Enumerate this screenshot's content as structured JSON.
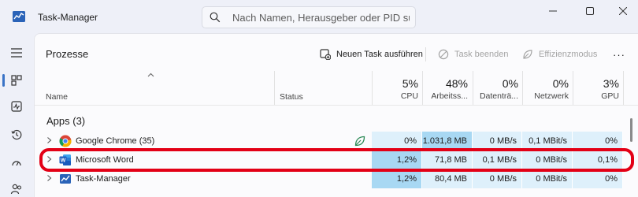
{
  "window": {
    "title": "Task-Manager",
    "search_placeholder": "Nach Namen, Herausgeber oder PID su..."
  },
  "toolbar": {
    "section_title": "Prozesse",
    "new_task_label": "Neuen Task ausführen",
    "end_task_label": "Task beenden",
    "efficiency_label": "Effizienzmodus",
    "more_label": "···"
  },
  "columns": {
    "name": "Name",
    "status": "Status",
    "cpu": {
      "pct": "5%",
      "label": "CPU"
    },
    "memory": {
      "pct": "48%",
      "label": "Arbeitss..."
    },
    "disk": {
      "pct": "0%",
      "label": "Datenträ..."
    },
    "network": {
      "pct": "0%",
      "label": "Netzwerk"
    },
    "gpu": {
      "pct": "3%",
      "label": "GPU"
    }
  },
  "group": {
    "title": "Apps (3)"
  },
  "rows": [
    {
      "name": "Google Chrome (35)",
      "icon": "chrome-icon",
      "status_icon": "efficiency-leaf-icon",
      "cpu": "0%",
      "memory": "1.031,8 MB",
      "disk": "0 MB/s",
      "network": "0,1 MBit/s",
      "gpu": "0%"
    },
    {
      "name": "Microsoft Word",
      "icon": "word-icon",
      "cpu": "1,2%",
      "memory": "71,8 MB",
      "disk": "0,1 MB/s",
      "network": "0 MBit/s",
      "gpu": "0,1%"
    },
    {
      "name": "Task-Manager",
      "icon": "task-manager-icon",
      "cpu": "1,2%",
      "memory": "80,4 MB",
      "disk": "0 MB/s",
      "network": "0 MBit/s",
      "gpu": "0%"
    }
  ],
  "heat_colors": {
    "light": "#def0fb",
    "medium": "#c3e5f7",
    "strong": "#a8d8f3"
  },
  "accent": "#e30016"
}
